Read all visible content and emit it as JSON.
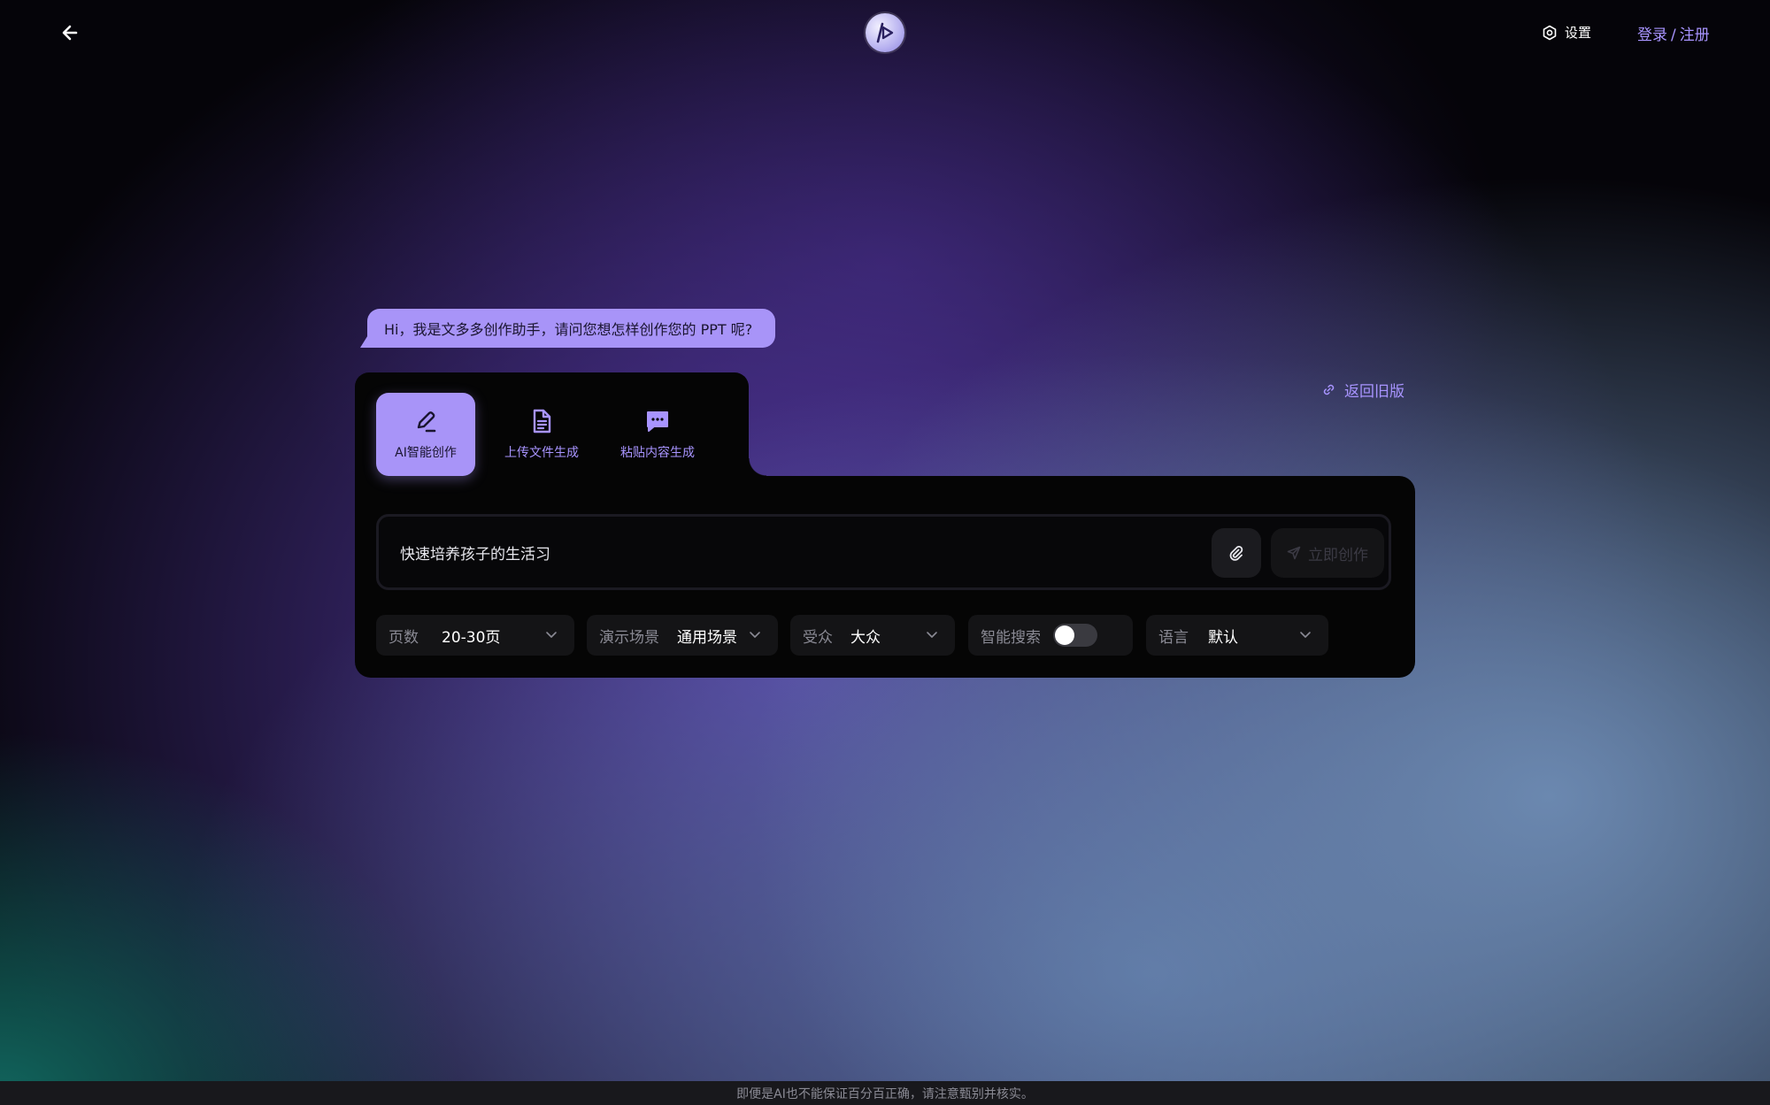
{
  "header": {
    "settings_label": "设置",
    "login_label": "登录",
    "login_separator": "/",
    "register_label": "注册"
  },
  "greeting": "Hi，我是文多多创作助手，请问您想怎样创作您的 PPT 呢?",
  "return_old_label": "返回旧版",
  "tabs": [
    {
      "label": "AI智能创作",
      "icon": "pen-icon",
      "active": true
    },
    {
      "label": "上传文件生成",
      "icon": "document-icon",
      "active": false
    },
    {
      "label": "粘贴内容生成",
      "icon": "chat-bubble-icon",
      "active": false
    }
  ],
  "input": {
    "value": "快速培养孩子的生活习",
    "create_label": "立即创作"
  },
  "options": {
    "pages": {
      "label": "页数",
      "value": "20-30页"
    },
    "scene": {
      "label": "演示场景",
      "value": "通用场景"
    },
    "audience": {
      "label": "受众",
      "value": "大众"
    },
    "smart_search": {
      "label": "智能搜索",
      "enabled": false
    },
    "language": {
      "label": "语言",
      "value": "默认"
    }
  },
  "footer_text": "即便是AI也不能保证百分百正确，请注意甄别并核实。",
  "colors": {
    "accent": "#a894f8",
    "panel": "#050505",
    "control": "#141416"
  }
}
